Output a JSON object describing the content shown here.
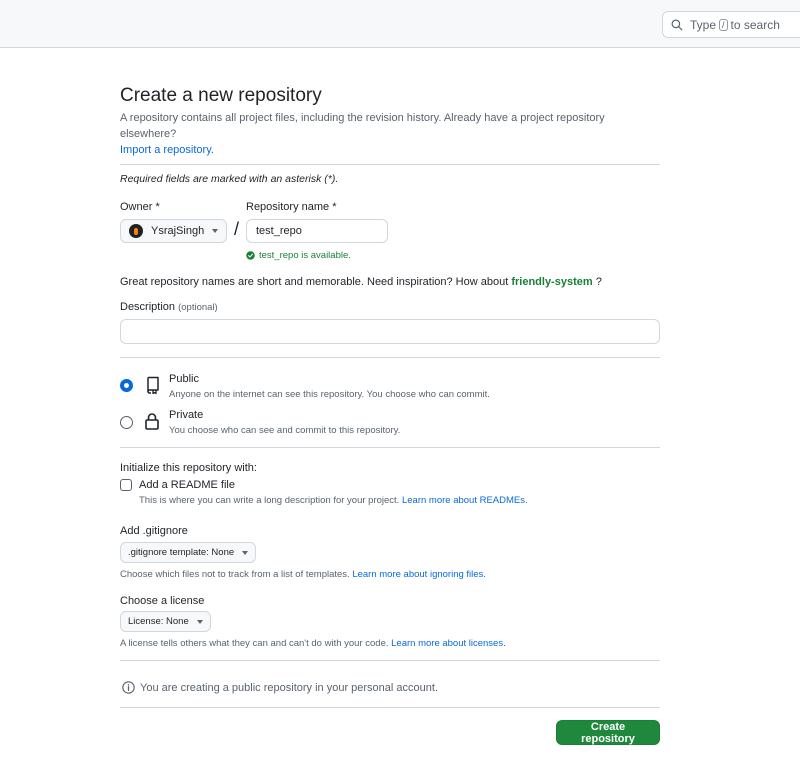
{
  "header": {
    "search_prefix": "Type",
    "search_key": "/",
    "search_suffix": "to search"
  },
  "page": {
    "title": "Create a new repository",
    "subtitle": "A repository contains all project files, including the revision history. Already have a project repository elsewhere?",
    "import_link": "Import a repository.",
    "required_note": "Required fields are marked with an asterisk (*)."
  },
  "owner": {
    "label": "Owner *",
    "value": "YsrajSingh"
  },
  "repo": {
    "label": "Repository name *",
    "value": "test_repo",
    "availability": "test_repo is available."
  },
  "inspiration": {
    "text": "Great repository names are short and memorable. Need inspiration? How about",
    "suggestion": "friendly-system",
    "suffix": "?"
  },
  "description": {
    "label": "Description",
    "optional": "(optional)",
    "value": ""
  },
  "visibility": {
    "public_title": "Public",
    "public_desc": "Anyone on the internet can see this repository. You choose who can commit.",
    "private_title": "Private",
    "private_desc": "You choose who can see and commit to this repository."
  },
  "init": {
    "title": "Initialize this repository with:",
    "readme_label": "Add a README file",
    "readme_desc": "This is where you can write a long description for your project.",
    "readme_link": "Learn more about READMEs."
  },
  "gitignore": {
    "title": "Add .gitignore",
    "select_label": ".gitignore template: None",
    "desc": "Choose which files not to track from a list of templates.",
    "link": "Learn more about ignoring files."
  },
  "license": {
    "title": "Choose a license",
    "select_label": "License: None",
    "desc": "A license tells others what they can and can't do with your code.",
    "link": "Learn more about licenses."
  },
  "notice": {
    "text": "You are creating a public repository in your personal account."
  },
  "actions": {
    "create_label": "Create repository"
  },
  "colors": {
    "accent_blue": "#0969da",
    "success_green": "#1a7f37",
    "button_green": "#1f883d"
  }
}
